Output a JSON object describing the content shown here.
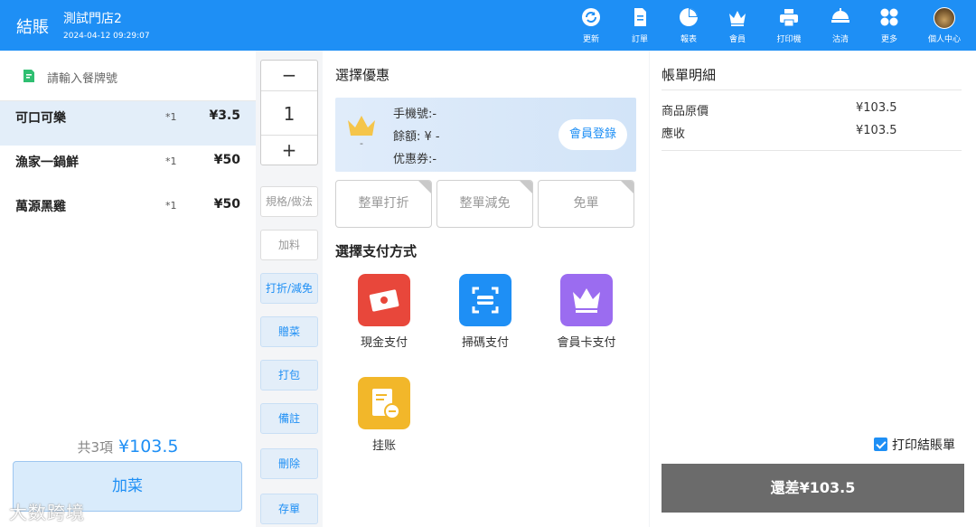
{
  "header": {
    "title": "結賬",
    "store_name": "測試門店2",
    "datetime": "2024-04-12 09:29:07",
    "nav": [
      {
        "label": "更新",
        "icon": "refresh-icon"
      },
      {
        "label": "訂單",
        "icon": "document-icon"
      },
      {
        "label": "報表",
        "icon": "pie-chart-icon"
      },
      {
        "label": "會員",
        "icon": "crown-icon"
      },
      {
        "label": "打印機",
        "icon": "printer-icon"
      },
      {
        "label": "沽清",
        "icon": "sold-out-icon"
      },
      {
        "label": "更多",
        "icon": "grid-icon"
      },
      {
        "label": "個人中心",
        "icon": "avatar-icon"
      }
    ]
  },
  "order": {
    "table_placeholder": "請輸入餐牌號",
    "items": [
      {
        "name": "可口可樂",
        "qty": "*1",
        "price": "¥3.5"
      },
      {
        "name": "漁家一鍋鮮",
        "qty": "*1",
        "price": "¥50"
      },
      {
        "name": "萬源黑雞",
        "qty": "*1",
        "price": "¥50"
      }
    ],
    "count_text": "共3項",
    "total": "¥103.5",
    "add_button": "加菜"
  },
  "watermark": "大数跨境",
  "ops": {
    "minus": "−",
    "quantity": "1",
    "plus": "+",
    "buttons": [
      "規格/做法",
      "加料",
      "打折/減免",
      "贈菜",
      "打包",
      "備註",
      "刪除",
      "存單"
    ]
  },
  "discount": {
    "heading": "選擇優惠",
    "member_level": "-",
    "phone": "手機號:-",
    "balance": "餘額: ¥ -",
    "coupon": "优惠券:-",
    "login_button": "會員登錄",
    "options": [
      "整單打折",
      "整單減免",
      "免單"
    ]
  },
  "payment": {
    "heading": "選擇支付方式",
    "methods": [
      {
        "label": "現金支付",
        "icon": "cash-icon",
        "color": "#e8473b"
      },
      {
        "label": "掃碼支付",
        "icon": "scan-icon",
        "color": "#1e8ff5"
      },
      {
        "label": "會員卡支付",
        "icon": "member-card-icon",
        "color": "#9b6cf0"
      },
      {
        "label": "挂账",
        "icon": "credit-account-icon",
        "color": "#f2b72a"
      }
    ]
  },
  "bill": {
    "heading": "帳單明細",
    "rows": [
      {
        "label": "商品原價",
        "value": "¥103.5"
      },
      {
        "label": "應收",
        "value": "¥103.5"
      }
    ],
    "print_receipt": "打印結賬單",
    "pay_button": "還差¥103.5"
  },
  "colors": {
    "accent": "#1e8ff5",
    "pay_button": "#6b6b6b"
  }
}
